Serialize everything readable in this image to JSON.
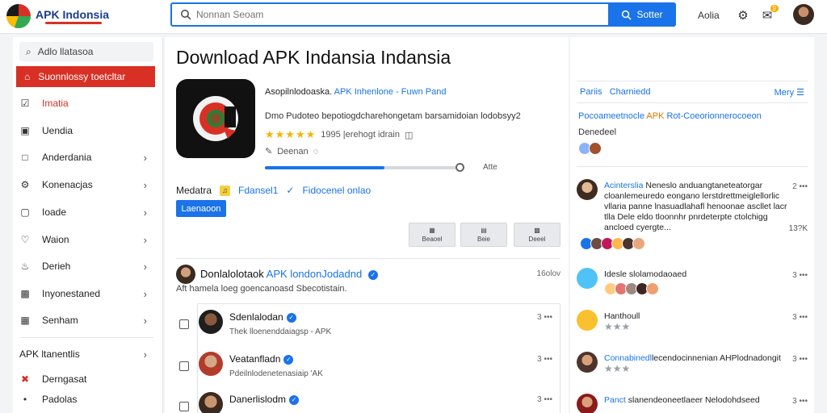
{
  "header": {
    "logo_text": "APK Indonsia",
    "search_placeholder": "Nonnan Seoam",
    "search_button": "Sotter",
    "link": "Aolia",
    "notif_count": "9"
  },
  "sidebar": {
    "search_label": "Adlo llatasoa",
    "active_item": "Suonnlossy toetcltar",
    "items": [
      {
        "label": "Imatia",
        "icon": "checkbox-icon",
        "chevron": false,
        "selected": true
      },
      {
        "label": "Uendia",
        "icon": "square-icon",
        "chevron": false,
        "selected": false
      },
      {
        "label": "Anderdania",
        "icon": "square-icon",
        "chevron": true,
        "selected": false
      },
      {
        "label": "Konenacjas",
        "icon": "gear-icon",
        "chevron": true,
        "selected": false
      },
      {
        "label": "Ioade",
        "icon": "square-icon",
        "chevron": true,
        "selected": false
      },
      {
        "label": "Waion",
        "icon": "heart-icon",
        "chevron": true,
        "selected": false
      },
      {
        "label": "Derieh",
        "icon": "bell-icon",
        "chevron": true,
        "selected": false
      },
      {
        "label": "Inyonestaned",
        "icon": "square-icon",
        "chevron": true,
        "selected": false
      },
      {
        "label": "Senham",
        "icon": "calendar-icon",
        "chevron": true,
        "selected": false
      }
    ],
    "section_item": "APK ltanentlis",
    "footer_items": [
      {
        "label": "Derngasat",
        "icon": "x-icon"
      },
      {
        "label": "Padolas",
        "icon": "dot-icon"
      }
    ]
  },
  "main": {
    "title": "Download APK Indansia  Indansia",
    "app_title_prefix": "Asopilnlodoaska.",
    "app_title_blue": "APK Inhenlone - Fuwn Pand",
    "app_desc": "Dmo Pudoteo bepotiogdcharehongetam barsamidoian lodobsyy2",
    "rating_stars": "★★★★★",
    "rating_text": "1995 |erehogt idrain",
    "review_label": "Deenan",
    "progress": 0.6,
    "progress_label": "Atte",
    "version_label": "Medatra",
    "version_link": "Fdansel1",
    "verified_link": "Fidocenel onlao",
    "download_button": "Laenaoon",
    "action_labels": [
      "Beaoel",
      "Beie",
      "Deeel"
    ],
    "comment": {
      "title_prefix": "Donlalolotaok",
      "title_blue": "APK londonJodadnd",
      "meta": "16olov",
      "sub": "Aft hamela loeg goencanoasd Sbecotistain."
    },
    "replies": [
      {
        "name": "Sdenlalodan",
        "sub": "Thek lloenenddaiagsp - APK",
        "more": "3 •••"
      },
      {
        "name": "Veatanfladn",
        "sub": "Pdeilnlodenetenasiaip 'AK",
        "more": "3 •••"
      },
      {
        "name": "Danerlislodm",
        "sub": "",
        "more": "3 •••"
      }
    ]
  },
  "right": {
    "head_left": "Pariis",
    "head_blue": "Charniedd",
    "head_right": "Mery",
    "feature_blue": "Pocoameetnocle",
    "feature_orange": "APK",
    "feature_blue2": "Rot-Coeorionnerocoeon",
    "dl_label": "Denedeel",
    "posts": [
      {
        "body_blue": "Acinterslia",
        "body": "Neneslo anduangtaneteatorgar cloanlemeuredo eongano lerstdrettmeiglellorlic vllaria panne lnasuadlahafl henoonae ascllet lacr tlla Dele eldo tloonnhr pnrdeterpte ctolchigg ancloed cyergte...",
        "count": "13?K",
        "more": "2 •••"
      },
      {
        "body_blue": "",
        "body": "Idesle slolamodaoaed",
        "count": "",
        "more": "3 •••"
      },
      {
        "body_blue": "",
        "body": "Hanthoull",
        "count": "",
        "more": "3 •••",
        "stars": "★★★"
      },
      {
        "body_blue": "Connabinedl",
        "body": "lecendocinnenian AHPlodnadongit",
        "count": "",
        "more": "3 •••",
        "stars": "★★★"
      },
      {
        "body_blue": "Panct",
        "body": "slanendeoneetlaeer Nelodohdseed",
        "count": "",
        "more": "3 •••"
      }
    ]
  }
}
